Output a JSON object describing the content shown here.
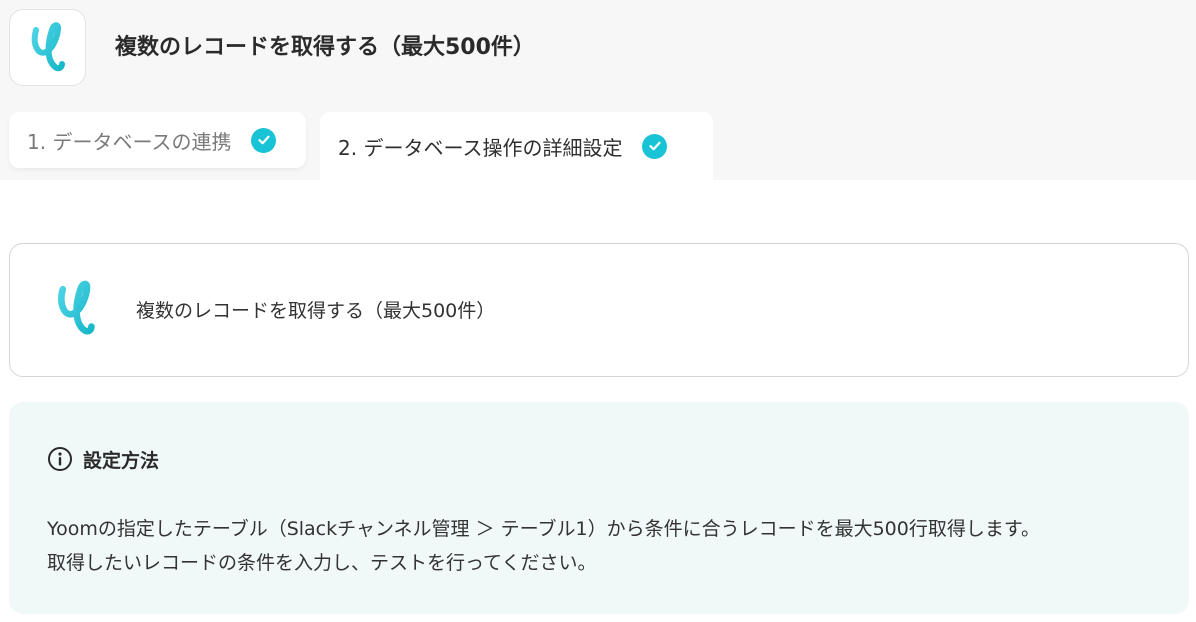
{
  "header": {
    "title": "複数のレコードを取得する（最大500件）",
    "app_icon": "yoom-logo"
  },
  "tabs": [
    {
      "label": "1. データベースの連携",
      "completed": true,
      "active": false,
      "icon": "check-circle-icon"
    },
    {
      "label": "2. データベース操作の詳細設定",
      "completed": true,
      "active": true,
      "icon": "check-circle-icon"
    }
  ],
  "operation_card": {
    "title": "複数のレコードを取得する（最大500件）",
    "icon": "yoom-logo"
  },
  "info": {
    "icon": "info-icon",
    "heading": "設定方法",
    "lines": [
      "Yoomの指定したテーブル（Slackチャンネル管理 ＞ テーブル1）から条件に合うレコードを最大500行取得します。",
      "取得したいレコードの条件を入力し、テストを行ってください。"
    ]
  },
  "colors": {
    "accent": "#19c3d6",
    "info_background": "#f1f9f8",
    "header_background": "#f7f7f7"
  }
}
